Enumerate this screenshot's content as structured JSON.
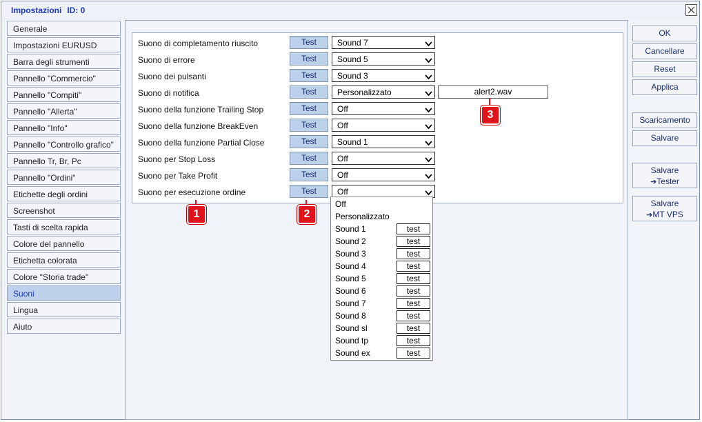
{
  "window": {
    "title": "Impostazioni",
    "id_label": "ID: 0"
  },
  "nav": {
    "items": [
      "Generale",
      "Impostazioni EURUSD",
      "Barra degli strumenti",
      "Pannello \"Commercio\"",
      "Pannello \"Compiti\"",
      "Pannello \"Allerta\"",
      "Pannello \"Info\"",
      "Pannello \"Controllo grafico\"",
      "Pannello Tr, Br, Pc",
      "Pannello \"Ordini\"",
      "Etichette degli ordini",
      "Screenshot",
      "Tasti di scelta rapida",
      "Colore del pannello",
      "Etichetta colorata",
      "Colore \"Storia trade\"",
      "Suoni",
      "Lingua",
      "Aiuto"
    ],
    "active": "Suoni"
  },
  "sounds": {
    "test_label": "Test",
    "rows": [
      {
        "label": "Suono di completamento riuscito",
        "value": "Sound 7"
      },
      {
        "label": "Suono di errore",
        "value": "Sound 5"
      },
      {
        "label": "Suono dei pulsanti",
        "value": "Sound 3"
      },
      {
        "label": "Suono di notifica",
        "value": "Personalizzato",
        "file": "alert2.wav"
      },
      {
        "label": "Suono della funzione Trailing Stop",
        "value": "Off"
      },
      {
        "label": "Suono della funzione BreakEven",
        "value": "Off"
      },
      {
        "label": "Suono della funzione Partial Close",
        "value": "Sound 1"
      },
      {
        "label": "Suono per Stop Loss",
        "value": "Off"
      },
      {
        "label": "Suono per Take Profit",
        "value": "Off"
      },
      {
        "label": "Suono per esecuzione ordine",
        "value": "Off"
      }
    ]
  },
  "dropdown": {
    "test_label": "test",
    "options": [
      {
        "label": "Off",
        "has_test": false
      },
      {
        "label": "Personalizzato",
        "has_test": false
      },
      {
        "label": "Sound 1",
        "has_test": true
      },
      {
        "label": "Sound 2",
        "has_test": true
      },
      {
        "label": "Sound 3",
        "has_test": true
      },
      {
        "label": "Sound 4",
        "has_test": true
      },
      {
        "label": "Sound 5",
        "has_test": true
      },
      {
        "label": "Sound 6",
        "has_test": true
      },
      {
        "label": "Sound 7",
        "has_test": true
      },
      {
        "label": "Sound 8",
        "has_test": true
      },
      {
        "label": "Sound sl",
        "has_test": true
      },
      {
        "label": "Sound tp",
        "has_test": true
      },
      {
        "label": "Sound ex",
        "has_test": true
      }
    ]
  },
  "actions": {
    "ok": "OK",
    "cancel": "Cancellare",
    "reset": "Reset",
    "apply": "Applica",
    "download": "Scaricamento",
    "save": "Salvare",
    "save_tester_line1": "Salvare",
    "save_tester_line2": "Tester",
    "save_vps_line1": "Salvare",
    "save_vps_line2": "MT VPS"
  },
  "markers": {
    "m1": "1",
    "m2": "2",
    "m3": "3"
  },
  "colors": {
    "accent": "#1f3bbd",
    "button_fill": "#bed1ea",
    "marker": "#e0141b"
  }
}
